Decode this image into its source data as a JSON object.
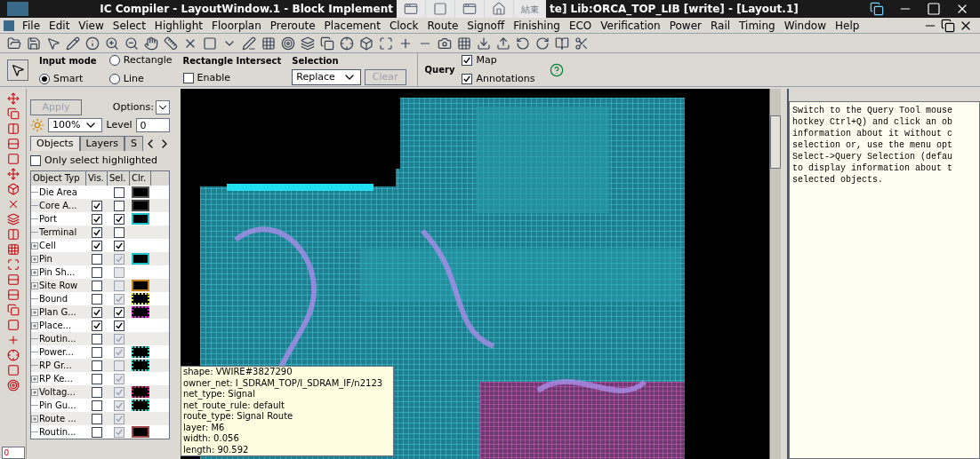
{
  "window": {
    "title_left": "IC Compiler - LayoutWindow.1 - Block Implement",
    "title_right": "te]  Lib:ORCA_TOP_LIB [write] - [Layout.1]",
    "overlay_label": "結束"
  },
  "menu": [
    "File",
    "Edit",
    "View",
    "Select",
    "Highlight",
    "Floorplan",
    "Preroute",
    "Placement",
    "Clock",
    "Route",
    "Signoff",
    "Finishing",
    "ECO",
    "Verification",
    "Power",
    "Rail",
    "Timing",
    "Window",
    "Help"
  ],
  "options_bar": {
    "input_mode_label": "Input mode",
    "input_modes": [
      {
        "label": "Rectangle",
        "selected": false
      },
      {
        "label": "Smart",
        "selected": true
      },
      {
        "label": "Line",
        "selected": false
      }
    ],
    "intersect_label": "Rectangle Intersect",
    "intersect": {
      "label": "Enable",
      "checked": false
    },
    "selection_label": "Selection",
    "selection_value": "Replace",
    "clear_button": {
      "label": "Clear",
      "disabled": true
    },
    "query_label": "Query",
    "query_options": [
      {
        "label": "Map",
        "checked": true
      },
      {
        "label": "Annotations",
        "checked": true
      }
    ]
  },
  "left_panel": {
    "apply_button": {
      "label": "Apply",
      "disabled": true
    },
    "options_label": "Options:",
    "brightness": "100%",
    "level_label": "Level",
    "level_value": "0",
    "tabs": [
      {
        "label": "Objects",
        "selected": true
      },
      {
        "label": "Layers",
        "selected": false
      },
      {
        "label": "S",
        "selected": false
      }
    ],
    "only_highlighted": {
      "label": "Only select highlighted",
      "checked": false
    },
    "columns": [
      "Object Typ",
      "Vis.",
      "Sel.",
      "Clr."
    ],
    "rows": [
      {
        "name": "Die Area",
        "expandable": false,
        "selectable": false,
        "sel_disabled": false,
        "swatch": {
          "kind": "solid",
          "color": "#555555"
        }
      },
      {
        "name": "Core A...",
        "expandable": false,
        "visible": true,
        "selectable": false,
        "sel_disabled": false,
        "swatch": {
          "kind": "solid",
          "color": "#444444"
        }
      },
      {
        "name": "Port",
        "expandable": false,
        "visible": true,
        "selectable": true,
        "sel_disabled": false,
        "swatch": {
          "kind": "solid",
          "color": "#20c0c8"
        }
      },
      {
        "name": "Terminal",
        "expandable": false,
        "visible": true,
        "selectable": false,
        "sel_disabled": false
      },
      {
        "name": "Cell",
        "expandable": true,
        "visible": true,
        "selectable": true,
        "sel_disabled": false
      },
      {
        "name": "Pin",
        "expandable": true,
        "visible": false,
        "selectable": true,
        "sel_disabled": true,
        "swatch": {
          "kind": "solid",
          "color": "#20c0c8"
        }
      },
      {
        "name": "Pin Sh...",
        "expandable": true,
        "visible": false,
        "selectable": false,
        "sel_disabled": true
      },
      {
        "name": "Site Row",
        "expandable": true,
        "visible": false,
        "selectable": false,
        "sel_disabled": true,
        "swatch": {
          "kind": "solid",
          "color": "#c08020"
        }
      },
      {
        "name": "Bound",
        "expandable": false,
        "visible": false,
        "selectable": true,
        "sel_disabled": true,
        "swatch": {
          "kind": "dotted",
          "color": "#e0e020"
        }
      },
      {
        "name": "Plan G...",
        "expandable": true,
        "visible": true,
        "selectable": true,
        "sel_disabled": false,
        "swatch": {
          "kind": "dotted",
          "color": "#e020e0"
        }
      },
      {
        "name": "Place...",
        "expandable": true,
        "visible": true,
        "selectable": true,
        "sel_disabled": false
      },
      {
        "name": "Routin...",
        "expandable": false,
        "visible": false,
        "selectable": true,
        "sel_disabled": true
      },
      {
        "name": "Power...",
        "expandable": false,
        "visible": false,
        "selectable": true,
        "sel_disabled": true,
        "swatch": {
          "kind": "dotted",
          "color": "#20d0c0"
        }
      },
      {
        "name": "RP Gr...",
        "expandable": false,
        "visible": false,
        "selectable": false,
        "sel_disabled": true,
        "swatch": {
          "kind": "dotted",
          "color": "#20d0c0"
        }
      },
      {
        "name": "RP Ke...",
        "expandable": true,
        "visible": false,
        "selectable": true,
        "sel_disabled": true
      },
      {
        "name": "Voltag...",
        "expandable": true,
        "visible": false,
        "selectable": true,
        "sel_disabled": true,
        "swatch": {
          "kind": "dotted",
          "color": "#d02080"
        }
      },
      {
        "name": "Pin Gu...",
        "expandable": false,
        "visible": false,
        "selectable": true,
        "sel_disabled": true,
        "swatch": {
          "kind": "dotted",
          "color": "#20d0c0"
        }
      },
      {
        "name": "Route ...",
        "expandable": true,
        "visible": false,
        "selectable": true,
        "sel_disabled": true
      },
      {
        "name": "Routin...",
        "expandable": false,
        "visible": false,
        "selectable": true,
        "sel_disabled": true,
        "swatch": {
          "kind": "solid",
          "color": "#a04848"
        }
      }
    ],
    "tool_field": "0"
  },
  "tooltip": [
    "shape:  VWIRE#3827290",
    "owner_net:  I_SDRAM_TOP/I_SDRAM_IF/n2123",
    "net_type:  Signal",
    "net_route_rule:  default",
    "route_type:  Signal  Route",
    "layer:  M6",
    "width:  0.056",
    "length:  90.592"
  ],
  "help_lines": [
    "Switch to the Query Tool mouse",
    "hotkey Ctrl+Q) and click an ob",
    "information about it without c",
    "selection or, use the menu opt",
    "Select->Query Selection (defau",
    "to display information about t",
    "selected objects."
  ]
}
